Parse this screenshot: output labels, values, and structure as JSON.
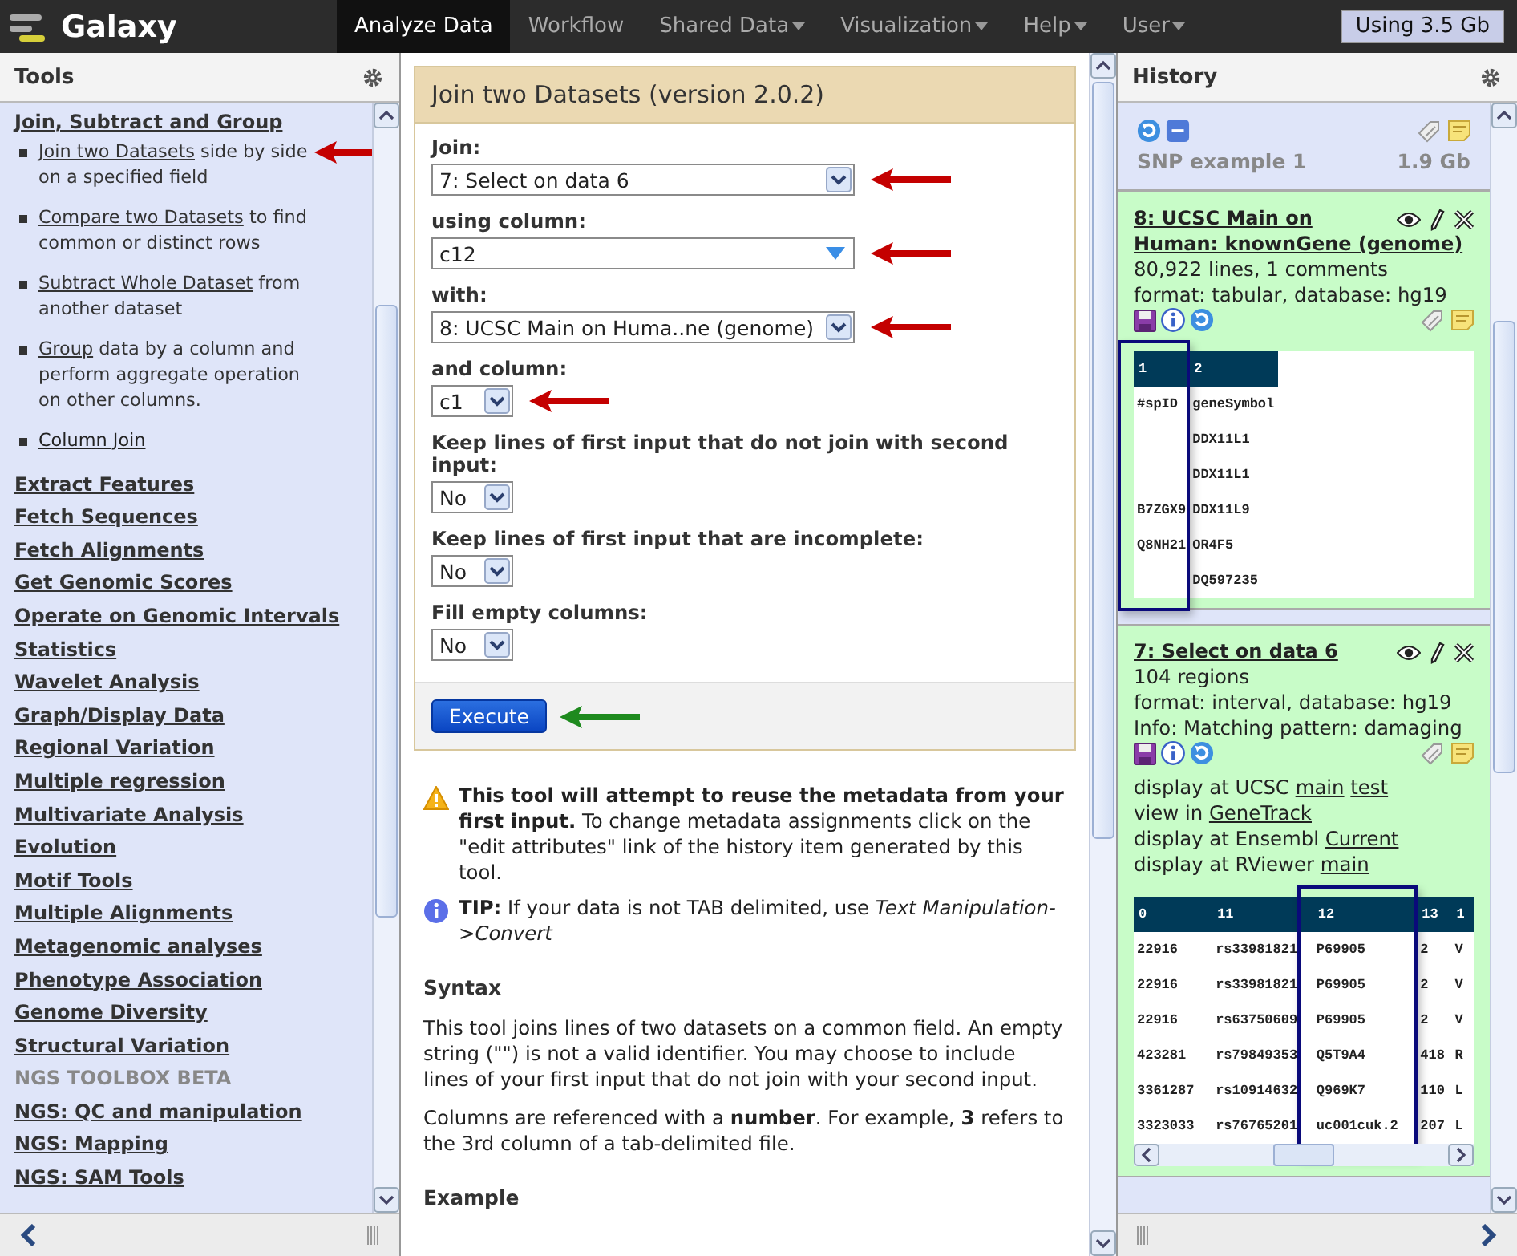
{
  "top_bar": {
    "logo": "Galaxy",
    "nav": [
      {
        "label": "Analyze Data",
        "selected": true,
        "dropdown": false
      },
      {
        "label": "Workflow",
        "selected": false,
        "dropdown": false
      },
      {
        "label": "Shared Data",
        "selected": false,
        "dropdown": true
      },
      {
        "label": "Visualization",
        "selected": false,
        "dropdown": true
      },
      {
        "label": "Help",
        "selected": false,
        "dropdown": true
      },
      {
        "label": "User",
        "selected": false,
        "dropdown": true
      }
    ],
    "usage": "Using 3.5 Gb"
  },
  "tools_panel": {
    "title": "Tools",
    "sections": [
      {
        "label": "Join, Subtract and Group",
        "kind": "link",
        "tools": [
          {
            "link": "Join two Datasets",
            "text": "side by side on a specified field",
            "arrow": {
              "color": "#c40000"
            }
          },
          {
            "link": "Compare two Datasets",
            "text": "to find common or distinct rows"
          },
          {
            "link": "Subtract Whole Dataset",
            "text": "from another dataset"
          },
          {
            "link": "Group",
            "text": "data by a column and perform aggregate operation on other columns."
          },
          {
            "link": "Column Join"
          }
        ]
      },
      {
        "label": "Extract Features",
        "kind": "link"
      },
      {
        "label": "Fetch Sequences",
        "kind": "link"
      },
      {
        "label": "Fetch Alignments",
        "kind": "link"
      },
      {
        "label": "Get Genomic Scores",
        "kind": "link"
      },
      {
        "label": "Operate on Genomic Intervals",
        "kind": "link"
      },
      {
        "label": "Statistics",
        "kind": "link"
      },
      {
        "label": "Wavelet Analysis",
        "kind": "link"
      },
      {
        "label": "Graph/Display Data",
        "kind": "link"
      },
      {
        "label": "Regional Variation",
        "kind": "link"
      },
      {
        "label": "Multiple regression",
        "kind": "link"
      },
      {
        "label": "Multivariate Analysis",
        "kind": "link"
      },
      {
        "label": "Evolution",
        "kind": "link"
      },
      {
        "label": "Motif Tools",
        "kind": "link"
      },
      {
        "label": "Multiple Alignments",
        "kind": "link"
      },
      {
        "label": "Metagenomic analyses",
        "kind": "link"
      },
      {
        "label": "Phenotype Association",
        "kind": "link"
      },
      {
        "label": "Genome Diversity",
        "kind": "link"
      },
      {
        "label": "Structural Variation",
        "kind": "link"
      },
      {
        "label": "NGS TOOLBOX BETA",
        "kind": "label"
      },
      {
        "label": "NGS: QC and manipulation",
        "kind": "link"
      },
      {
        "label": "NGS: Mapping",
        "kind": "link"
      },
      {
        "label": "NGS: SAM Tools",
        "kind": "link"
      }
    ]
  },
  "tool_form": {
    "title": "Join two Datasets (version 2.0.2)",
    "fields": [
      {
        "label": "Join:",
        "value": "7: Select on data 6",
        "kind": "select",
        "arrow": {
          "color": "#c40000"
        }
      },
      {
        "label": "using column:",
        "value": "c12",
        "kind": "combo",
        "arrow": {
          "color": "#c40000"
        }
      },
      {
        "label": "with:",
        "value": "8: UCSC Main on Huma..ne (genome)",
        "kind": "select",
        "arrow": {
          "color": "#c40000"
        }
      },
      {
        "label": "and column:",
        "value": "c1",
        "kind": "mini",
        "arrow": {
          "color": "#c40000"
        }
      },
      {
        "label": "Keep lines of first input that do not join with second input:",
        "value": "No",
        "kind": "mini"
      },
      {
        "label": "Keep lines of first input that are incomplete:",
        "value": "No",
        "kind": "mini"
      },
      {
        "label": "Fill empty columns:",
        "value": "No",
        "kind": "mini"
      }
    ],
    "execute": "Execute",
    "execute_arrow": {
      "color": "#1e8a1e"
    },
    "warning": "**This tool will attempt to reuse the metadata from your first input.** To change metadata assignments click on the \"edit attributes\" link of the history item generated by this tool.",
    "tip": "**TIP:** If your data is not TAB delimited, use *Text Manipulation->Convert*",
    "syntax_heading": "Syntax",
    "paragraphs": [
      "This tool joins lines of two datasets on a common field. An empty string (\"\") is not a valid identifier. You may choose to include lines of your first input that do not join with your second input.",
      "Columns are referenced with a **number**. For example, **3** refers to the 3rd column of a tab-delimited file."
    ],
    "example_heading": "Example"
  },
  "history": {
    "title": "History",
    "name": "SNP example 1",
    "size": "1.9 Gb",
    "datasets": [
      {
        "title": "8: UCSC Main on Human: knownGene (genome)",
        "info": [
          "80,922 lines, 1 comments",
          "format: tabular, database: hg19"
        ],
        "peek": {
          "scroll": false,
          "columns": [
            {
              "header": "1",
              "highlighted": true,
              "cells": [
                "#spID",
                null,
                null,
                "B7ZGX9",
                "Q8NH21",
                null
              ]
            },
            {
              "header": "2",
              "highlighted": false,
              "cells": [
                "geneSymbol",
                "DDX11L1",
                "DDX11L1",
                "DDX11L9",
                "OR4F5",
                "DQ597235"
              ]
            }
          ]
        }
      },
      {
        "title": "7: Select on data 6",
        "info": [
          "104 regions",
          "format: interval, database: hg19",
          "Info: Matching pattern: damaging"
        ],
        "links": [
          {
            "text": "display at UCSC",
            "links": [
              "main",
              "test"
            ]
          },
          {
            "text": "view in",
            "links": [
              "GeneTrack"
            ]
          },
          {
            "text": "display at Ensembl",
            "links": [
              "Current"
            ]
          },
          {
            "text": "display at RViewer",
            "links": [
              "main"
            ]
          }
        ],
        "peek": {
          "scroll": true,
          "columns": [
            {
              "header": "0",
              "highlighted": false,
              "cells": [
                "22916",
                "22916",
                "22916",
                "423281",
                "3361287",
                "3323033"
              ]
            },
            {
              "header": "11",
              "highlighted": false,
              "cells": [
                "rs33981821",
                "rs33981821",
                "rs63750609",
                "rs79849353",
                "rs10914632",
                "rs76765201"
              ]
            },
            {
              "header": "12",
              "highlighted": true,
              "cells": [
                "P69905",
                "P69905",
                "P69905",
                "Q5T9A4",
                "Q969K7",
                "uc001cuk.2"
              ]
            },
            {
              "header": "13",
              "highlighted": false,
              "cells": [
                "2",
                "2",
                "2",
                "418",
                "110",
                "207"
              ]
            },
            {
              "header": "1",
              "highlighted": false,
              "cells": [
                "V",
                "V",
                "V",
                "R",
                "L",
                "L"
              ]
            }
          ]
        }
      }
    ]
  }
}
